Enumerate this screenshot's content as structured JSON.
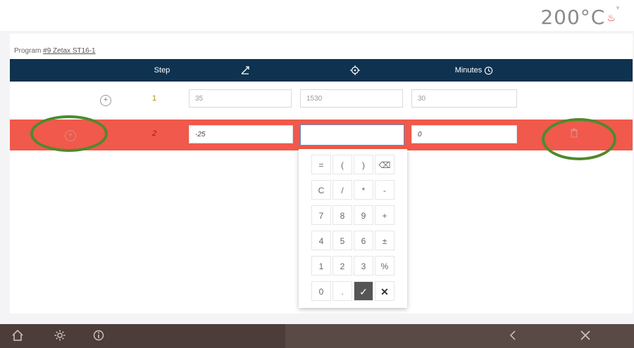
{
  "header": {
    "temperature": "200°C"
  },
  "program": {
    "prefix": "Program",
    "name": "#9 Zetax ST16-1"
  },
  "table": {
    "columns": {
      "step": "Step",
      "minutes": "Minutes"
    },
    "rows": [
      {
        "step": "1",
        "rate": "35",
        "temperature": "1530",
        "minutes": "30"
      },
      {
        "step": "2",
        "rate": "-25",
        "temperature": "",
        "minutes": "0"
      }
    ]
  },
  "keypad": {
    "keys": [
      "=",
      "(",
      ")",
      "⌫",
      "C",
      "/",
      "*",
      "-",
      "7",
      "8",
      "9",
      "+",
      "4",
      "5",
      "6",
      "±",
      "1",
      "2",
      "3",
      "%",
      "0",
      ".",
      "✓",
      "✕"
    ]
  },
  "colors": {
    "header_bar": "#0e3250",
    "selected_row": "#f0594b",
    "annotation": "#4f8a2c",
    "bottom_bar": "#5a4a46"
  },
  "icons": {
    "add_step": "plus-circle-icon",
    "rate": "ramp-rate-icon",
    "target": "crosshair-icon",
    "clock": "clock-icon",
    "trash": "trash-icon",
    "home": "home-icon",
    "settings": "gear-icon",
    "info": "info-icon",
    "back": "chevron-left-icon",
    "close": "close-icon"
  }
}
